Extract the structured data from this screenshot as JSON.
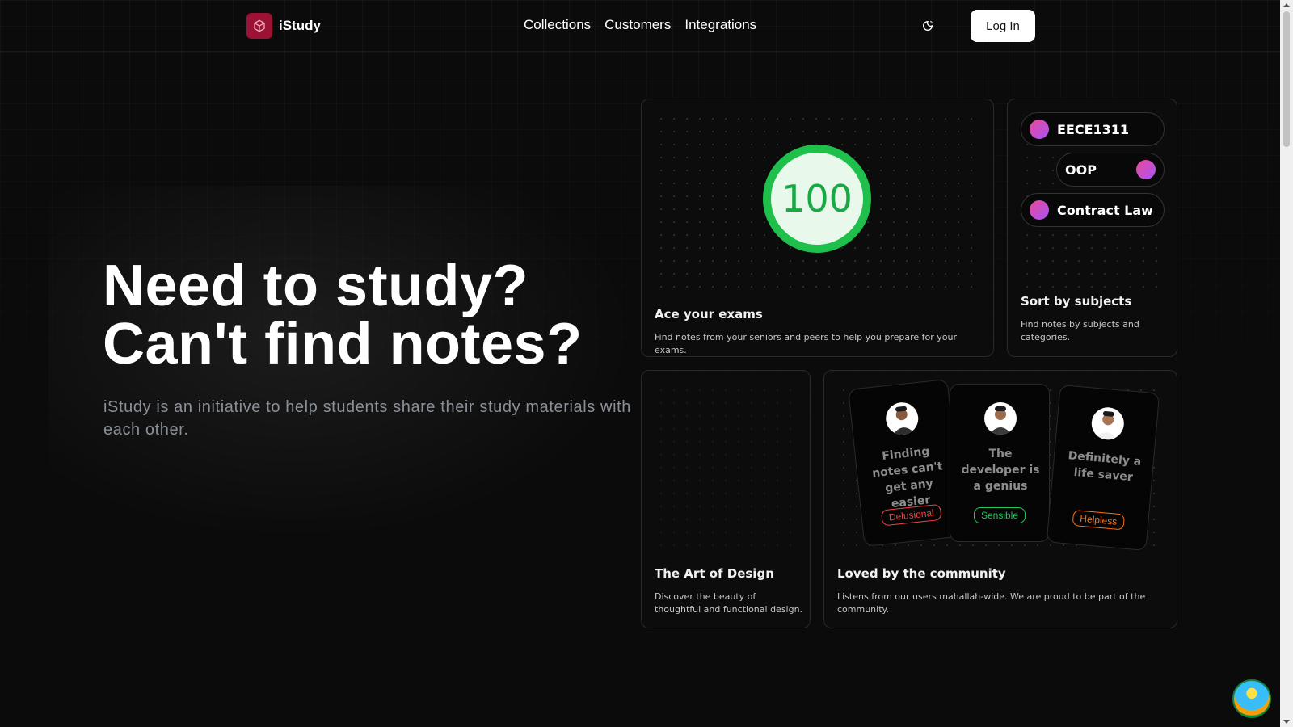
{
  "header": {
    "brand": "iStudy",
    "nav": [
      "Collections",
      "Customers",
      "Integrations"
    ],
    "login_label": "Log In",
    "theme_icon": "moon-sun-icon"
  },
  "hero": {
    "title_line1": "Need to study?",
    "title_line2": "Can't find notes?",
    "subtitle": "iStudy is an initiative to help students share their study materials with each other."
  },
  "cards": {
    "exams": {
      "score": "100",
      "title": "Ace your exams",
      "desc": "Find notes from your seniors and peers to help you prepare for your exams."
    },
    "subjects": {
      "pills": [
        "EECE1311",
        "OOP",
        "Contract Law"
      ],
      "title": "Sort by subjects",
      "desc": "Find notes by subjects and categories."
    },
    "design": {
      "title": "The Art of Design",
      "desc": "Discover the beauty of thoughtful and functional design."
    },
    "community": {
      "title": "Loved by the community",
      "desc": "Listens from our users mahallah-wide. We are proud to be part of the community.",
      "testimonials": [
        {
          "quote": "Finding notes can't get any easier",
          "tag": "Delusional",
          "tag_color": "#ef4444"
        },
        {
          "quote": "The developer is a genius",
          "tag": "Sensible",
          "tag_color": "#22c55e"
        },
        {
          "quote": "Definitely a life saver",
          "tag": "Helpless",
          "tag_color": "#f97316"
        }
      ]
    }
  },
  "colors": {
    "accent": "#9b1235",
    "score_green": "#1fbf4b",
    "pill_gradient": [
      "#ec4899",
      "#a855f7"
    ]
  }
}
